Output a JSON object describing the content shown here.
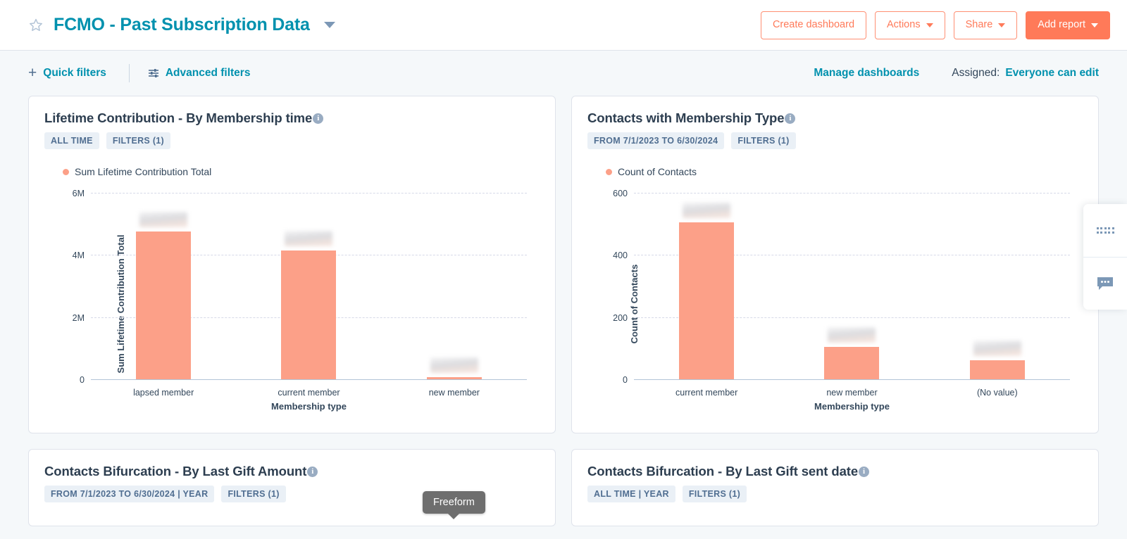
{
  "header": {
    "star_icon": "star-outline-icon",
    "title": "FCMO - Past Subscription Data",
    "title_caret": "chevron-down-icon",
    "buttons": {
      "create_dashboard": "Create dashboard",
      "actions": "Actions",
      "share": "Share",
      "add_report": "Add report"
    },
    "accent_color": "#FF7A59",
    "title_color": "#0091AE"
  },
  "filterbar": {
    "quick_filters": "Quick filters",
    "advanced_filters": "Advanced filters",
    "manage_dashboards": "Manage dashboards",
    "assigned_label": "Assigned:",
    "assigned_value": "Everyone can edit"
  },
  "cards": [
    {
      "title": "Lifetime Contribution - By Membership time",
      "chips": [
        "ALL TIME",
        "FILTERS (1)"
      ]
    },
    {
      "title": "Contacts with Membership Type",
      "chips": [
        "FROM 7/1/2023 TO 6/30/2024",
        "FILTERS (1)"
      ]
    },
    {
      "title": "Contacts Bifurcation - By Last Gift Amount",
      "chips": [
        "FROM 7/1/2023 TO 6/30/2024 | YEAR",
        "FILTERS (1)"
      ]
    },
    {
      "title": "Contacts Bifurcation - By Last Gift sent date",
      "chips": [
        "ALL TIME | YEAR",
        "FILTERS (1)"
      ]
    }
  ],
  "tooltip": {
    "label": "Freeform"
  },
  "side_panel": {
    "grid_icon": "dots-grid-icon",
    "chat_icon": "chat-bubble-icon"
  },
  "chart_data": [
    {
      "type": "bar",
      "title": "Lifetime Contribution - By Membership time",
      "legend": [
        "Sum Lifetime Contribution Total"
      ],
      "legend_position": "top-left",
      "categories": [
        "lapsed member",
        "current member",
        "new member"
      ],
      "values": [
        4750000,
        4150000,
        60000
      ],
      "value_labels_redacted": true,
      "xlabel": "Membership type",
      "ylabel": "Sum Lifetime Contribution Total",
      "yticks": [
        "0",
        "2M",
        "4M",
        "6M"
      ],
      "ytick_values": [
        0,
        2000000,
        4000000,
        6000000
      ],
      "ylim": [
        0,
        6000000
      ],
      "grid": true,
      "series_color": "#FCA088"
    },
    {
      "type": "bar",
      "title": "Contacts with Membership Type",
      "legend": [
        "Count of Contacts"
      ],
      "legend_position": "top-left",
      "categories": [
        "current member",
        "new member",
        "(No value)"
      ],
      "values": [
        505,
        105,
        62
      ],
      "value_labels_redacted": true,
      "xlabel": "Membership type",
      "ylabel": "Count of Contacts",
      "yticks": [
        "0",
        "200",
        "400",
        "600"
      ],
      "ytick_values": [
        0,
        200,
        400,
        600
      ],
      "ylim": [
        0,
        600
      ],
      "grid": true,
      "series_color": "#FCA088"
    }
  ]
}
